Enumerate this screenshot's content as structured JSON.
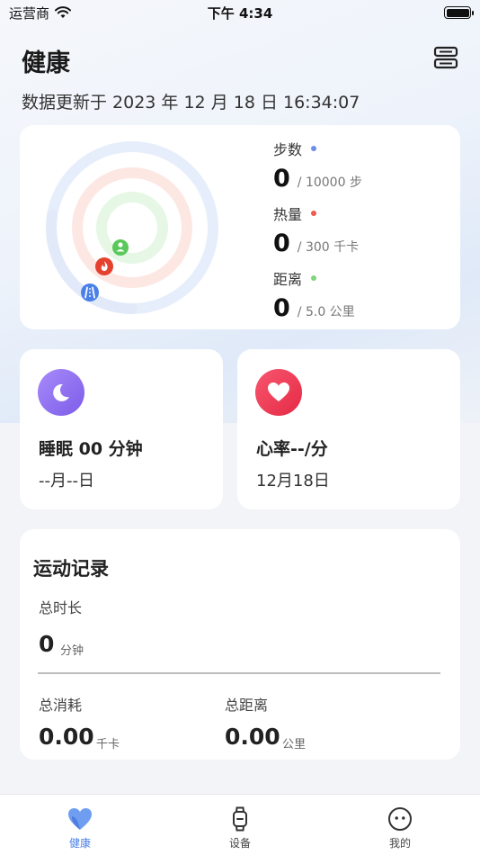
{
  "status_bar": {
    "carrier": "运营商",
    "time": "下午 4:34"
  },
  "header": {
    "title": "健康",
    "update_text": "数据更新于 2023 年 12 月 18 日 16:34:07"
  },
  "activity": {
    "stats": [
      {
        "label": "步数",
        "value": "0",
        "goal": "/ 10000 步",
        "color": "#6b8ee8"
      },
      {
        "label": "热量",
        "value": "0",
        "goal": "/ 300 千卡",
        "color": "#f05a4a"
      },
      {
        "label": "距离",
        "value": "0",
        "goal": "/ 5.0 公里",
        "color": "#7ed67a"
      }
    ],
    "ring_icons": [
      "person-icon",
      "flame-icon",
      "road-icon"
    ]
  },
  "sleep": {
    "title": "睡眠 00 分钟",
    "date": "--月--日",
    "icon": "moon-icon",
    "color": "#8b6cf0"
  },
  "heart": {
    "title": "心率--/分",
    "date": "12月18日",
    "icon": "heart-icon",
    "color": "#ee3e55"
  },
  "exercise": {
    "title": "运动记录",
    "total_time_label": "总时长",
    "total_time_value": "0",
    "total_time_unit": "分钟",
    "calories_label": "总消耗",
    "calories_value": "0.00",
    "calories_unit": "千卡",
    "distance_label": "总距离",
    "distance_value": "0.00",
    "distance_unit": "公里"
  },
  "tabs": [
    {
      "label": "健康",
      "icon": "heart-tab-icon",
      "active": true
    },
    {
      "label": "设备",
      "icon": "watch-icon",
      "active": false
    },
    {
      "label": "我的",
      "icon": "profile-icon",
      "active": false
    }
  ],
  "accent": "#4a80e8"
}
